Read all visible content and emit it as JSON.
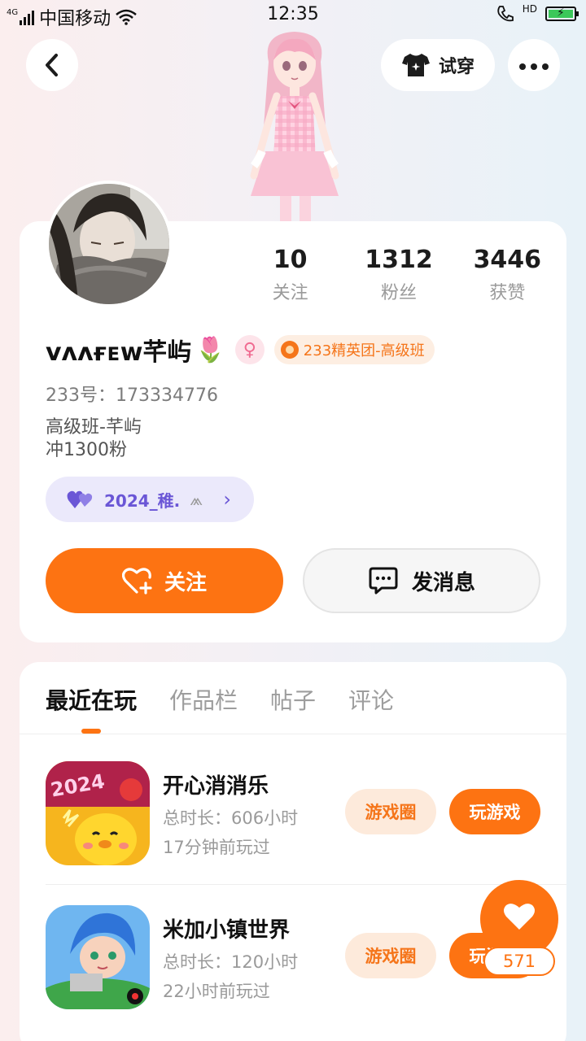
{
  "status_bar": {
    "network": "4G",
    "carrier": "中国移动",
    "time": "12:35",
    "hd": "HD",
    "battery_level": 0.95
  },
  "header": {
    "tryon_label": "试穿",
    "icons": [
      "back-arrow-icon",
      "tshirt-icon",
      "more-dots-icon"
    ]
  },
  "profile": {
    "stats": [
      {
        "value": "10",
        "label": "关注"
      },
      {
        "value": "1312",
        "label": "粉丝"
      },
      {
        "value": "3446",
        "label": "获赞"
      }
    ],
    "name": "ᴠᴧᴧғᴇᴡ芊屿",
    "name_emoji": "🌷",
    "gender_symbol": "♀",
    "group_badge": "233精英团-高级班",
    "uid": "233号：173334776",
    "bio_line1": "高级班-芊屿",
    "bio_line2": "冲1300粉",
    "pair_label": "2024_稚.",
    "follow_label": "关注",
    "message_label": "发消息"
  },
  "tabs": [
    {
      "label": "最近在玩",
      "active": true
    },
    {
      "label": "作品栏",
      "active": false
    },
    {
      "label": "帖子",
      "active": false
    },
    {
      "label": "评论",
      "active": false
    }
  ],
  "games": [
    {
      "title": "开心消消乐",
      "duration": "总时长：606小时",
      "recent": "17分钟前玩过",
      "circle_label": "游戏圈",
      "play_label": "玩游戏",
      "icon_text": "2024"
    },
    {
      "title": "米加小镇世界",
      "duration": "总时长：120小时",
      "recent": "22小时前玩过",
      "circle_label": "游戏圈",
      "play_label": "玩游戏"
    }
  ],
  "like_fab": {
    "count": "571"
  },
  "colors": {
    "accent": "#fd7312",
    "accent_light": "#fdeadb",
    "pair_purple": "#6a56d6",
    "pink": "#f06b91"
  }
}
